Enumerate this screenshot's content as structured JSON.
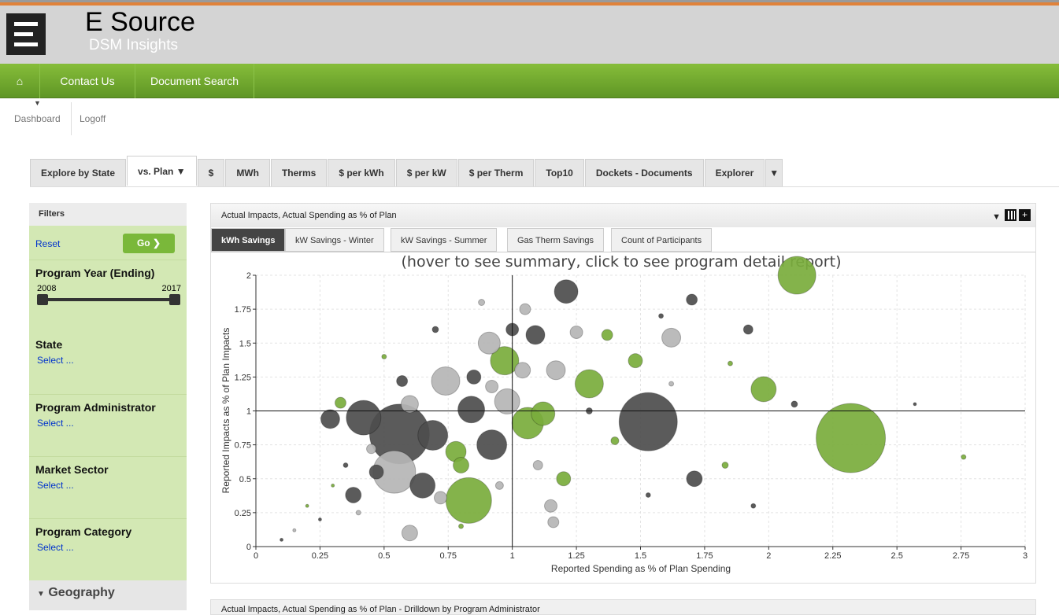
{
  "header": {
    "brand": "E Source",
    "subtitle": "DSM Insights"
  },
  "nav": {
    "items": [
      "Contact Us",
      "Document Search"
    ]
  },
  "subnav": {
    "dashboard": "Dashboard",
    "logoff": "Logoff"
  },
  "tabs": [
    "Explore by State",
    "vs. Plan",
    "$",
    "MWh",
    "Therms",
    "$ per kWh",
    "$ per kW",
    "$ per Therm",
    "Top10",
    "Dockets - Documents",
    "Explorer"
  ],
  "sidebar": {
    "title": "Filters",
    "reset": "Reset",
    "go": "Go",
    "year_label": "Program Year (Ending)",
    "year_min": "2008",
    "year_max": "2017",
    "sections": [
      {
        "label": "State",
        "select": "Select ..."
      },
      {
        "label": "Program Administrator",
        "select": "Select ..."
      },
      {
        "label": "Market Sector",
        "select": "Select ..."
      },
      {
        "label": "Program Category",
        "select": "Select ..."
      }
    ],
    "geography": "Geography"
  },
  "panel": {
    "title": "Actual Impacts, Actual Spending as % of Plan",
    "tabs": [
      "kWh Savings",
      "kW Savings - Winter",
      "kW Savings - Summer",
      "Gas Therm Savings",
      "Count of Participants"
    ]
  },
  "panel2": {
    "title": "Actual Impacts, Actual Spending as % of Plan - Drilldown by Program Administrator"
  },
  "colors": {
    "dark": "#4d4d4d",
    "light": "#b5b5b5",
    "green": "#7aad3c"
  },
  "chart_data": {
    "type": "scatter",
    "title": "(hover to see summary, click to see program detail report)",
    "xlabel": "Reported Spending as % of Plan Spending",
    "ylabel": "Reported Impacts as % of Plan Impacts",
    "xlim": [
      0,
      3
    ],
    "ylim": [
      0,
      2
    ],
    "xticks": [
      "0",
      "0.25",
      "0.5",
      "0.75",
      "1",
      "1.25",
      "1.5",
      "1.75",
      "2",
      "2.25",
      "2.5",
      "2.75",
      "3"
    ],
    "yticks": [
      "0",
      "0.25",
      "0.5",
      "0.75",
      "1",
      "1.25",
      "1.5",
      "1.75",
      "2"
    ],
    "grid": true,
    "reference_lines": {
      "x": 1,
      "y": 1
    },
    "points": [
      {
        "x": 0.56,
        "y": 0.83,
        "z": 38,
        "c": "dark"
      },
      {
        "x": 2.32,
        "y": 0.8,
        "z": 44,
        "c": "green"
      },
      {
        "x": 1.53,
        "y": 0.92,
        "z": 37,
        "c": "dark"
      },
      {
        "x": 0.54,
        "y": 0.55,
        "z": 27,
        "c": "light"
      },
      {
        "x": 0.83,
        "y": 0.34,
        "z": 29,
        "c": "green"
      },
      {
        "x": 2.11,
        "y": 2.0,
        "z": 24,
        "c": "green"
      },
      {
        "x": 0.42,
        "y": 0.95,
        "z": 22,
        "c": "dark"
      },
      {
        "x": 0.69,
        "y": 0.82,
        "z": 19,
        "c": "dark"
      },
      {
        "x": 0.92,
        "y": 0.75,
        "z": 19,
        "c": "dark"
      },
      {
        "x": 1.06,
        "y": 0.91,
        "z": 20,
        "c": "green"
      },
      {
        "x": 0.97,
        "y": 1.37,
        "z": 18,
        "c": "green"
      },
      {
        "x": 0.74,
        "y": 1.22,
        "z": 18,
        "c": "light"
      },
      {
        "x": 1.3,
        "y": 1.2,
        "z": 18,
        "c": "green"
      },
      {
        "x": 0.84,
        "y": 1.01,
        "z": 17,
        "c": "dark"
      },
      {
        "x": 0.98,
        "y": 1.07,
        "z": 16,
        "c": "light"
      },
      {
        "x": 0.65,
        "y": 0.45,
        "z": 16,
        "c": "dark"
      },
      {
        "x": 1.98,
        "y": 1.16,
        "z": 16,
        "c": "green"
      },
      {
        "x": 1.21,
        "y": 1.88,
        "z": 15,
        "c": "dark"
      },
      {
        "x": 1.12,
        "y": 0.98,
        "z": 15,
        "c": "green"
      },
      {
        "x": 0.91,
        "y": 1.5,
        "z": 14,
        "c": "light"
      },
      {
        "x": 1.09,
        "y": 1.56,
        "z": 12,
        "c": "dark"
      },
      {
        "x": 1.62,
        "y": 1.54,
        "z": 12,
        "c": "light"
      },
      {
        "x": 0.29,
        "y": 0.94,
        "z": 12,
        "c": "dark"
      },
      {
        "x": 0.78,
        "y": 0.7,
        "z": 13,
        "c": "green"
      },
      {
        "x": 1.17,
        "y": 1.3,
        "z": 12,
        "c": "light"
      },
      {
        "x": 0.6,
        "y": 1.05,
        "z": 11,
        "c": "light"
      },
      {
        "x": 1.71,
        "y": 0.5,
        "z": 10,
        "c": "dark"
      },
      {
        "x": 1.04,
        "y": 1.3,
        "z": 10,
        "c": "light"
      },
      {
        "x": 0.8,
        "y": 0.6,
        "z": 10,
        "c": "green"
      },
      {
        "x": 0.38,
        "y": 0.38,
        "z": 10,
        "c": "dark"
      },
      {
        "x": 0.6,
        "y": 0.1,
        "z": 10,
        "c": "light"
      },
      {
        "x": 1.48,
        "y": 1.37,
        "z": 9,
        "c": "green"
      },
      {
        "x": 1.15,
        "y": 0.3,
        "z": 8,
        "c": "light"
      },
      {
        "x": 1.2,
        "y": 0.5,
        "z": 9,
        "c": "green"
      },
      {
        "x": 0.85,
        "y": 1.25,
        "z": 9,
        "c": "dark"
      },
      {
        "x": 0.47,
        "y": 0.55,
        "z": 9,
        "c": "dark"
      },
      {
        "x": 1.25,
        "y": 1.58,
        "z": 8,
        "c": "light"
      },
      {
        "x": 1.0,
        "y": 1.6,
        "z": 8,
        "c": "dark"
      },
      {
        "x": 1.7,
        "y": 1.82,
        "z": 7,
        "c": "dark"
      },
      {
        "x": 1.92,
        "y": 1.6,
        "z": 6,
        "c": "dark"
      },
      {
        "x": 0.72,
        "y": 0.36,
        "z": 8,
        "c": "light"
      },
      {
        "x": 1.16,
        "y": 0.18,
        "z": 7,
        "c": "light"
      },
      {
        "x": 1.05,
        "y": 1.75,
        "z": 7,
        "c": "light"
      },
      {
        "x": 0.92,
        "y": 1.18,
        "z": 8,
        "c": "light"
      },
      {
        "x": 0.57,
        "y": 1.22,
        "z": 7,
        "c": "dark"
      },
      {
        "x": 1.37,
        "y": 1.56,
        "z": 7,
        "c": "green"
      },
      {
        "x": 0.45,
        "y": 0.72,
        "z": 6,
        "c": "light"
      },
      {
        "x": 0.33,
        "y": 1.06,
        "z": 7,
        "c": "green"
      },
      {
        "x": 2.1,
        "y": 1.05,
        "z": 4,
        "c": "dark"
      },
      {
        "x": 2.76,
        "y": 0.66,
        "z": 3,
        "c": "green"
      },
      {
        "x": 1.94,
        "y": 0.3,
        "z": 3,
        "c": "dark"
      },
      {
        "x": 1.53,
        "y": 0.38,
        "z": 3,
        "c": "dark"
      },
      {
        "x": 1.83,
        "y": 0.6,
        "z": 4,
        "c": "green"
      },
      {
        "x": 0.25,
        "y": 0.2,
        "z": 2,
        "c": "dark"
      },
      {
        "x": 0.15,
        "y": 0.12,
        "z": 2,
        "c": "light"
      },
      {
        "x": 0.2,
        "y": 0.3,
        "z": 2,
        "c": "green"
      },
      {
        "x": 0.35,
        "y": 0.6,
        "z": 3,
        "c": "dark"
      },
      {
        "x": 0.5,
        "y": 1.4,
        "z": 3,
        "c": "green"
      },
      {
        "x": 0.7,
        "y": 1.6,
        "z": 4,
        "c": "dark"
      },
      {
        "x": 0.88,
        "y": 1.8,
        "z": 4,
        "c": "light"
      },
      {
        "x": 1.4,
        "y": 0.78,
        "z": 5,
        "c": "green"
      },
      {
        "x": 1.1,
        "y": 0.6,
        "z": 6,
        "c": "light"
      },
      {
        "x": 0.95,
        "y": 0.45,
        "z": 5,
        "c": "light"
      },
      {
        "x": 1.3,
        "y": 1.0,
        "z": 4,
        "c": "dark"
      },
      {
        "x": 0.8,
        "y": 0.15,
        "z": 3,
        "c": "green"
      },
      {
        "x": 0.4,
        "y": 0.25,
        "z": 3,
        "c": "light"
      },
      {
        "x": 1.58,
        "y": 1.7,
        "z": 3,
        "c": "dark"
      },
      {
        "x": 1.85,
        "y": 1.35,
        "z": 3,
        "c": "green"
      },
      {
        "x": 2.57,
        "y": 1.05,
        "z": 2,
        "c": "dark"
      },
      {
        "x": 0.1,
        "y": 0.05,
        "z": 2,
        "c": "dark"
      },
      {
        "x": 0.3,
        "y": 0.45,
        "z": 2,
        "c": "green"
      },
      {
        "x": 1.62,
        "y": 1.2,
        "z": 3,
        "c": "light"
      }
    ]
  }
}
